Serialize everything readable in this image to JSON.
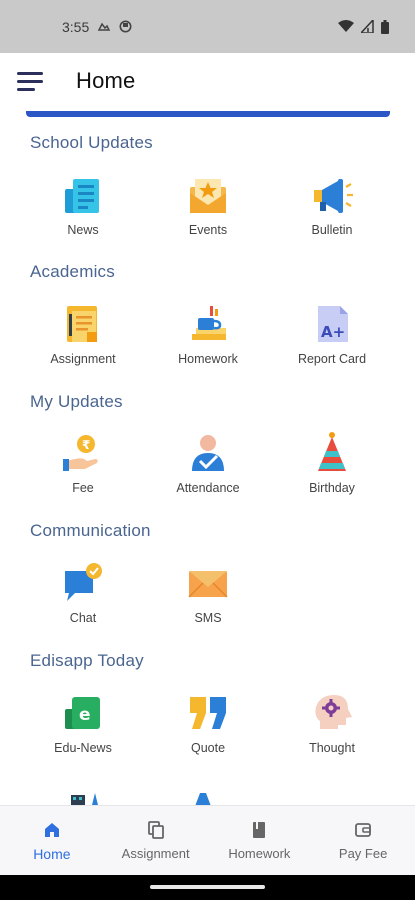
{
  "status_bar": {
    "time": "3:55",
    "icons": [
      "notification-icon",
      "clock-icon",
      "wifi-icon",
      "signal-icon",
      "battery-icon"
    ]
  },
  "app_bar": {
    "title": "Home",
    "menu_icon": "hamburger-menu-icon"
  },
  "colors": {
    "accent": "#2a56c6",
    "section_title": "#4a6590",
    "active_nav": "#2f6fe0"
  },
  "sections": [
    {
      "title": "School Updates",
      "items": [
        {
          "label": "News",
          "icon": "news-icon"
        },
        {
          "label": "Events",
          "icon": "events-icon"
        },
        {
          "label": "Bulletin",
          "icon": "bulletin-icon"
        }
      ]
    },
    {
      "title": "Academics",
      "items": [
        {
          "label": "Assignment",
          "icon": "assignment-icon"
        },
        {
          "label": "Homework",
          "icon": "homework-icon"
        },
        {
          "label": "Report Card",
          "icon": "report-card-icon"
        }
      ]
    },
    {
      "title": "My Updates",
      "items": [
        {
          "label": "Fee",
          "icon": "fee-icon"
        },
        {
          "label": "Attendance",
          "icon": "attendance-icon"
        },
        {
          "label": "Birthday",
          "icon": "birthday-icon"
        }
      ]
    },
    {
      "title": "Communication",
      "items": [
        {
          "label": "Chat",
          "icon": "chat-icon"
        },
        {
          "label": "SMS",
          "icon": "sms-icon"
        }
      ]
    },
    {
      "title": "Edisapp Today",
      "items": [
        {
          "label": "Edu-News",
          "icon": "edu-news-icon"
        },
        {
          "label": "Quote",
          "icon": "quote-icon"
        },
        {
          "label": "Thought",
          "icon": "thought-icon"
        }
      ]
    }
  ],
  "bottom_nav": [
    {
      "label": "Home",
      "icon": "home-icon",
      "active": true
    },
    {
      "label": "Assignment",
      "icon": "copy-icon",
      "active": false
    },
    {
      "label": "Homework",
      "icon": "book-icon",
      "active": false
    },
    {
      "label": "Pay Fee",
      "icon": "wallet-icon",
      "active": false
    }
  ]
}
